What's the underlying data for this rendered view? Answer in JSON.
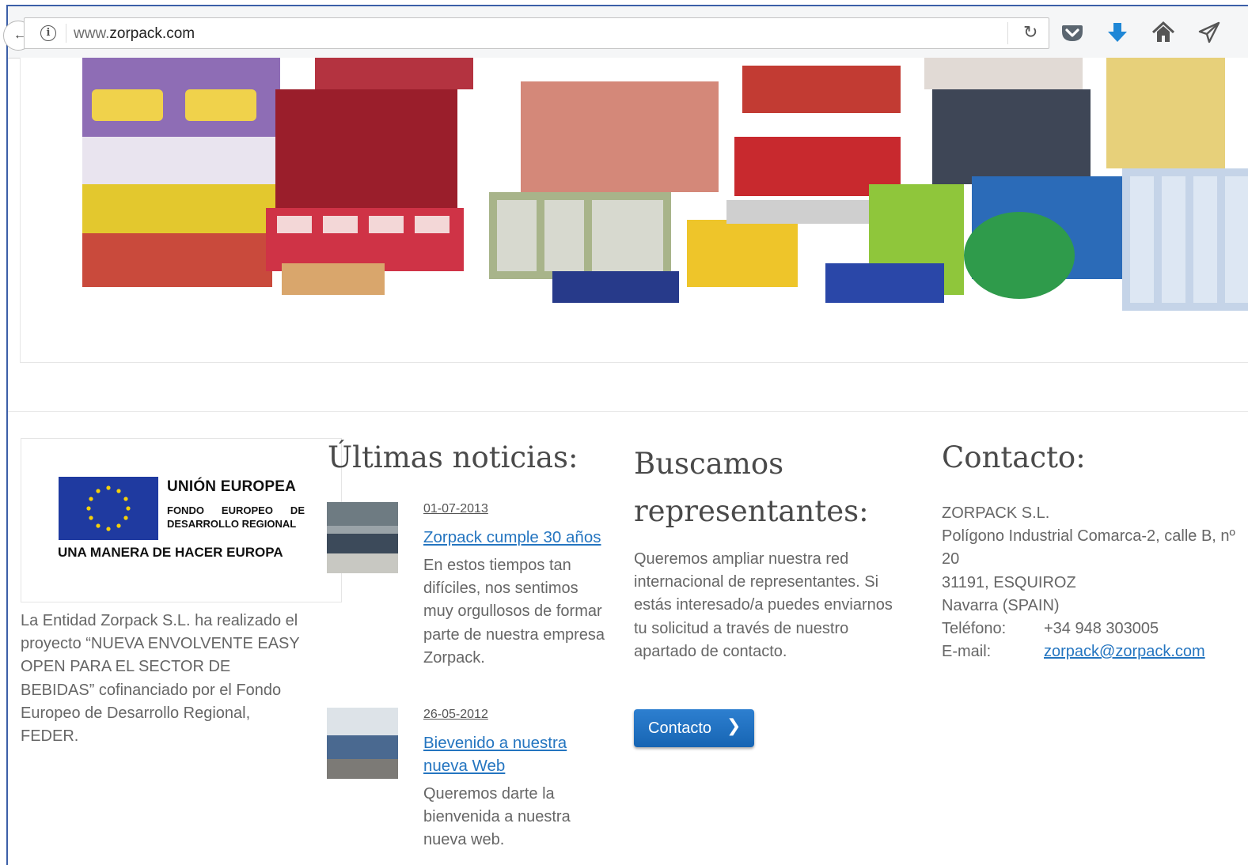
{
  "browser": {
    "url_prefix": "www.",
    "url_domain": "zorpack.com",
    "icons": [
      "info-icon",
      "reload-icon",
      "pocket-icon",
      "download-icon",
      "home-icon",
      "send-icon"
    ],
    "accent": "#1f87d6"
  },
  "eu": {
    "title": "UNIÓN EUROPEA",
    "fund": "FONDO EUROPEO DE DESARROLLO REGIONAL",
    "motto": "UNA MANERA DE HACER EUROPA",
    "flag_color": "#1f3aa0",
    "star_color": "#f5d10a",
    "description": "La Entidad Zorpack S.L. ha realizado el proyecto “NUEVA ENVOLVENTE EASY OPEN PARA EL SECTOR DE BEBIDAS” cofinanciado por el Fondo Europeo de Desarrollo Regional, FEDER."
  },
  "news": {
    "heading": "Últimas noticias:",
    "items": [
      {
        "date": "01-07-2013",
        "title": "Zorpack cumple 30 años",
        "body": "En estos tiempos tan difíciles, nos sentimos muy orgullosos de formar parte de nuestra empresa Zorpack."
      },
      {
        "date": "26-05-2012",
        "title": "Bievenido a nuestra nueva Web",
        "body": "Queremos darte la bienvenida a nuestra nueva web."
      }
    ]
  },
  "representatives": {
    "heading": "Buscamos representantes:",
    "text": "Queremos ampliar nuestra red internacional de representantes. Si estás interesado/a puedes enviarnos tu solicitud a través de nuestro apartado de contacto.",
    "button": "Contacto",
    "button_color": "#1f72c4"
  },
  "contact": {
    "heading": "Contacto:",
    "company": "ZORPACK S.L.",
    "address_1": "Polígono Industrial Comarca-2, calle B, nº 20",
    "address_2": "31191, ESQUIROZ",
    "address_3": "Navarra (SPAIN)",
    "phone_label": "Teléfono:",
    "phone": "+34 948 303005",
    "email_label": "E-mail:",
    "email": "zorpack@zorpack.com",
    "link_color": "#2475c0"
  }
}
